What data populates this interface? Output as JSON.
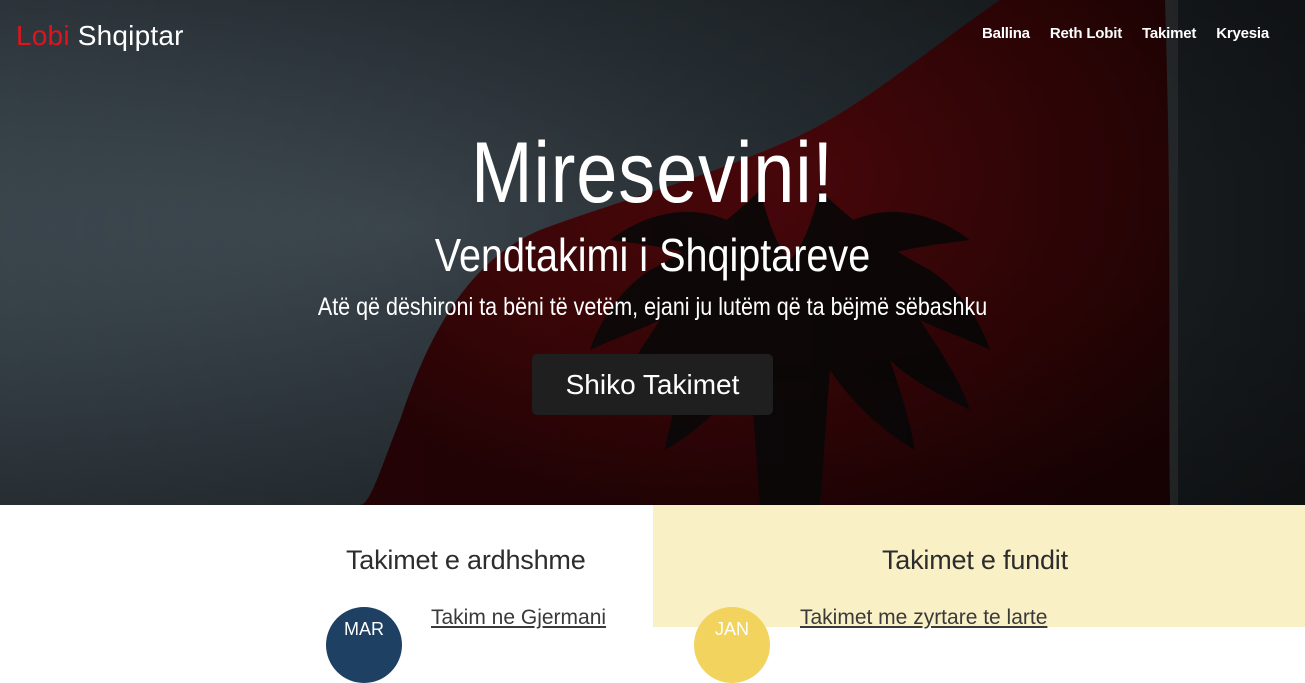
{
  "brand": {
    "accent": "Lobi",
    "rest": "Shqiptar"
  },
  "nav": {
    "items": [
      {
        "label": "Ballina"
      },
      {
        "label": "Reth Lobit"
      },
      {
        "label": "Takimet"
      },
      {
        "label": "Kryesia"
      }
    ]
  },
  "hero": {
    "title": "Miresevini!",
    "subtitle": "Vendtakimi i Shqiptareve",
    "tagline": "Atë që dëshironi ta bëni të vetëm, ejani ju lutëm që ta bëjmë sëbashku",
    "button_label": "Shiko Takimet"
  },
  "upcoming": {
    "title": "Takimet e ardhshme",
    "events": [
      {
        "month": "MAR",
        "title": "Takim ne Gjermani"
      }
    ]
  },
  "recent": {
    "title": "Takimet e fundit",
    "events": [
      {
        "month": "JAN",
        "title": "Takimet me zyrtare te larte"
      }
    ]
  },
  "colors": {
    "accent_red": "#e0141c",
    "upcoming_badge": "#1e4063",
    "recent_badge": "#f2d35e",
    "recent_bg": "#faf0c6",
    "button_bg": "#1f1f1f"
  }
}
